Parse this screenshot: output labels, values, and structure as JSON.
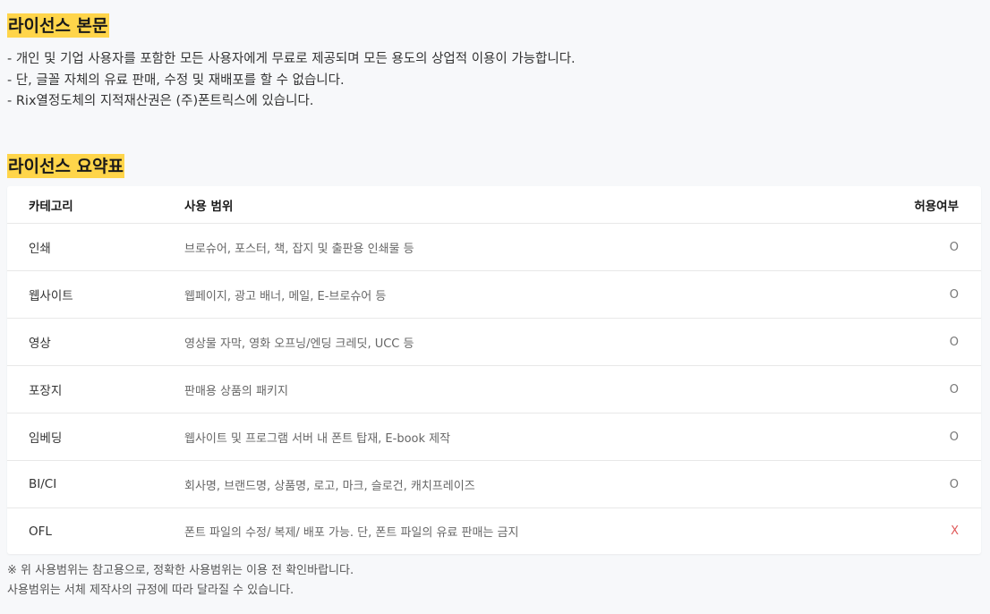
{
  "license_body": {
    "heading": "라이선스 본문",
    "lines": [
      "- 개인 및 기업 사용자를 포함한 모든 사용자에게 무료로 제공되며 모든 용도의 상업적 이용이 가능합니다.",
      "- 단, 글꼴 자체의 유료 판매, 수정 및 재배포를 할 수 없습니다.",
      "- Rix열정도체의 지적재산권은 (주)폰트릭스에 있습니다."
    ]
  },
  "license_summary": {
    "heading": "라이선스 요약표",
    "columns": [
      "카테고리",
      "사용 범위",
      "허용여부"
    ],
    "rows": [
      {
        "category": "인쇄",
        "scope": "브로슈어, 포스터, 책, 잡지 및 출판용 인쇄물 등",
        "allowed": "O"
      },
      {
        "category": "웹사이트",
        "scope": "웹페이지, 광고 배너, 메일, E-브로슈어 등",
        "allowed": "O"
      },
      {
        "category": "영상",
        "scope": "영상물 자막, 영화 오프닝/엔딩 크레딧, UCC 등",
        "allowed": "O"
      },
      {
        "category": "포장지",
        "scope": "판매용 상품의 패키지",
        "allowed": "O"
      },
      {
        "category": "임베딩",
        "scope": "웹사이트 및 프로그램 서버 내 폰트 탑재, E-book 제작",
        "allowed": "O"
      },
      {
        "category": "BI/CI",
        "scope": "회사명, 브랜드명, 상품명, 로고, 마크, 슬로건, 캐치프레이즈",
        "allowed": "O"
      },
      {
        "category": "OFL",
        "scope": "폰트 파일의 수정/ 복제/ 배포 가능. 단, 폰트 파일의 유료 판매는 금지",
        "allowed": "X"
      }
    ],
    "colors": {
      "highlight": "#ffd54a",
      "allowed_mark": "#777777",
      "denied_mark": "#e05a5a"
    }
  },
  "notes": [
    "※ 위 사용범위는 참고용으로, 정확한 사용범위는 이용 전 확인바랍니다.",
    "사용범위는 서체 제작사의 규정에 따라 달라질 수 있습니다."
  ]
}
